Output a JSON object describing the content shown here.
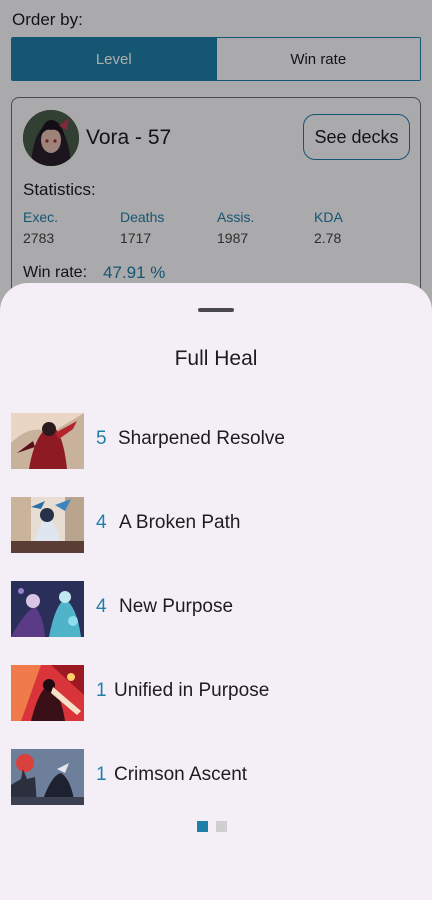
{
  "order": {
    "label": "Order by:",
    "options": [
      "Level",
      "Win rate"
    ],
    "selected": "Level"
  },
  "hero": {
    "name": "Vora - 57",
    "see_decks_label": "See decks",
    "statistics_label": "Statistics:",
    "stats": [
      {
        "label": "Exec.",
        "value": "2783"
      },
      {
        "label": "Deaths",
        "value": "1717"
      },
      {
        "label": "Assis.",
        "value": "1987"
      },
      {
        "label": "KDA",
        "value": "2.78"
      }
    ],
    "win_rate_label": "Win rate:",
    "win_rate_value": "47.91 %"
  },
  "sheet": {
    "title": "Full Heal",
    "decks": [
      {
        "count": "5",
        "name": "Sharpened Resolve",
        "art": "red-warrior-art"
      },
      {
        "count": "4",
        "name": "A Broken Path",
        "art": "blue-spirit-art"
      },
      {
        "count": "4",
        "name": "New Purpose",
        "art": "twin-mages-art"
      },
      {
        "count": "1",
        "name": "Unified in Purpose",
        "art": "crimson-blade-art"
      },
      {
        "count": "1",
        "name": "Crimson Ascent",
        "art": "moonlit-castle-art"
      }
    ],
    "page_count": 2,
    "current_page": 1
  },
  "colors": {
    "accent": "#1f7fa8",
    "sheet_bg": "#f4eff7"
  }
}
